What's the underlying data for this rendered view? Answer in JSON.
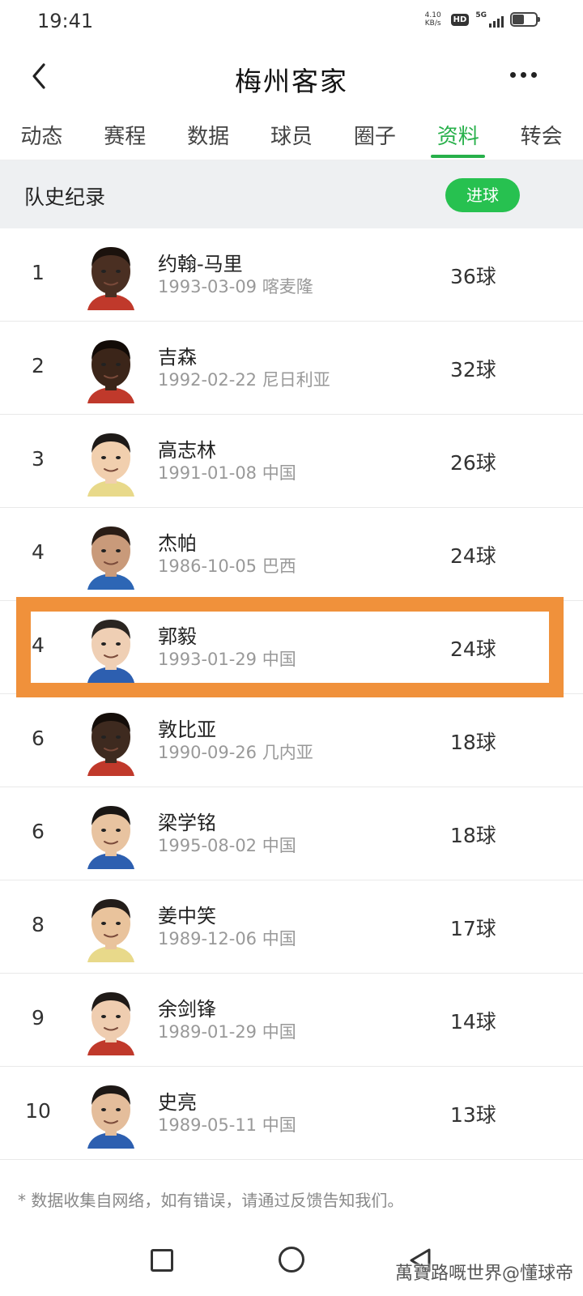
{
  "status_bar": {
    "time": "19:41",
    "net_speed_value": "4.10",
    "net_speed_unit": "KB/s",
    "hd": "HD",
    "network": "5G"
  },
  "header": {
    "title": "梅州客家"
  },
  "tabs": [
    {
      "label": "动态",
      "active": false
    },
    {
      "label": "赛程",
      "active": false
    },
    {
      "label": "数据",
      "active": false
    },
    {
      "label": "球员",
      "active": false
    },
    {
      "label": "圈子",
      "active": false
    },
    {
      "label": "资料",
      "active": true
    },
    {
      "label": "转会",
      "active": false
    }
  ],
  "section": {
    "title": "队史纪录",
    "filter_button": "进球"
  },
  "players": [
    {
      "rank": "1",
      "name": "约翰-马里",
      "info": "1993-03-09 喀麦隆",
      "goals": "36球",
      "skin": "#4a2f22",
      "hair": "#1b120d",
      "shirt": "#c0392b"
    },
    {
      "rank": "2",
      "name": "吉森",
      "info": "1992-02-22 尼日利亚",
      "goals": "32球",
      "skin": "#3b2519",
      "hair": "#120b07",
      "shirt": "#c0392b"
    },
    {
      "rank": "3",
      "name": "高志林",
      "info": "1991-01-08 中国",
      "goals": "26球",
      "skin": "#f1cfae",
      "hair": "#1e1a18",
      "shirt": "#e8d98a"
    },
    {
      "rank": "4",
      "name": "杰帕",
      "info": "1986-10-05 巴西",
      "goals": "24球",
      "skin": "#c99a7a",
      "hair": "#2a1d16",
      "shirt": "#2d66b5"
    },
    {
      "rank": "4",
      "name": "郭毅",
      "info": "1993-01-29 中国",
      "goals": "24球",
      "skin": "#efcfb4",
      "hair": "#2a2521",
      "shirt": "#2d5fb0"
    },
    {
      "rank": "6",
      "name": "敦比亚",
      "info": "1990-09-26 几内亚",
      "goals": "18球",
      "skin": "#3e2a1f",
      "hair": "#140d09",
      "shirt": "#c0392b"
    },
    {
      "rank": "6",
      "name": "梁学铭",
      "info": "1995-08-02 中国",
      "goals": "18球",
      "skin": "#e8c3a0",
      "hair": "#1a1614",
      "shirt": "#2d5fb0"
    },
    {
      "rank": "8",
      "name": "姜中笑",
      "info": "1989-12-06 中国",
      "goals": "17球",
      "skin": "#e9c39c",
      "hair": "#231d1a",
      "shirt": "#e8d98a"
    },
    {
      "rank": "9",
      "name": "余剑锋",
      "info": "1989-01-29 中国",
      "goals": "14球",
      "skin": "#efcdb0",
      "hair": "#1f1a17",
      "shirt": "#c0392b"
    },
    {
      "rank": "10",
      "name": "史亮",
      "info": "1989-05-11 中国",
      "goals": "13球",
      "skin": "#e4bd9b",
      "hair": "#1d1815",
      "shirt": "#2d5fb0"
    }
  ],
  "footnote": "* 数据收集自网络，如有错误，请通过反馈告知我们。",
  "watermark": "萬寶路嘅世界@懂球帝",
  "colors": {
    "accent": "#27b04a",
    "button_green": "#27c150",
    "highlight_orange": "#f0913b",
    "section_bg": "#eef0f2"
  }
}
